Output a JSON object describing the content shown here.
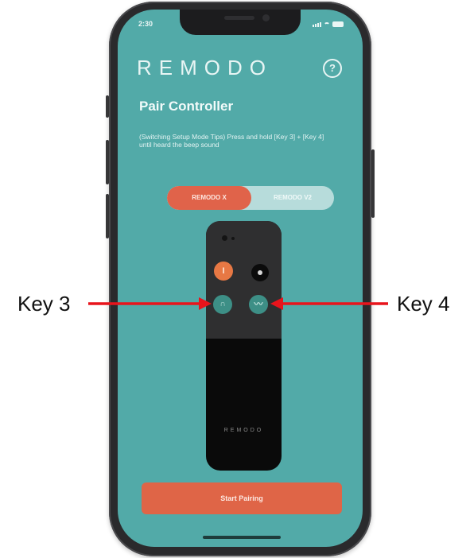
{
  "status_bar": {
    "time": "2:30"
  },
  "header": {
    "brand": "REMODO",
    "help_icon_glyph": "?"
  },
  "page": {
    "title": "Pair Controller",
    "description": "(Switching Setup Mode Tips) Press and hold [Key 3] + [Key 4] until heard the beep sound"
  },
  "segmented_control": {
    "options": [
      "REMODO X",
      "REMODO V2"
    ],
    "selected": "REMODO X"
  },
  "remote": {
    "key1_glyph": "I",
    "key3_glyph": "∩",
    "key4_glyph": "〰",
    "logo": "REMODO"
  },
  "footer": {
    "start_label": "Start Pairing"
  },
  "annotations": {
    "left_label": "Key 3",
    "right_label": "Key 4",
    "arrow_color": "#e8141c"
  },
  "colors": {
    "screen_bg": "#52aaa8",
    "accent": "#df6547",
    "segment_inactive": "#b7dcdb"
  },
  "icons": [
    "help-icon",
    "signal-icon",
    "wifi-icon",
    "battery-icon",
    "arrow-icon"
  ]
}
